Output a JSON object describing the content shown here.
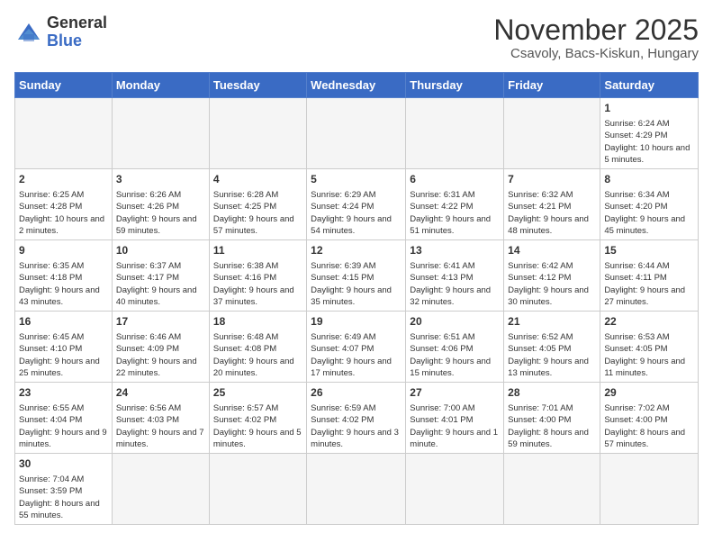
{
  "logo": {
    "text_general": "General",
    "text_blue": "Blue"
  },
  "header": {
    "month": "November 2025",
    "location": "Csavoly, Bacs-Kiskun, Hungary"
  },
  "weekdays": [
    "Sunday",
    "Monday",
    "Tuesday",
    "Wednesday",
    "Thursday",
    "Friday",
    "Saturday"
  ],
  "weeks": [
    [
      {
        "day": "",
        "info": ""
      },
      {
        "day": "",
        "info": ""
      },
      {
        "day": "",
        "info": ""
      },
      {
        "day": "",
        "info": ""
      },
      {
        "day": "",
        "info": ""
      },
      {
        "day": "",
        "info": ""
      },
      {
        "day": "1",
        "info": "Sunrise: 6:24 AM\nSunset: 4:29 PM\nDaylight: 10 hours and 5 minutes."
      }
    ],
    [
      {
        "day": "2",
        "info": "Sunrise: 6:25 AM\nSunset: 4:28 PM\nDaylight: 10 hours and 2 minutes."
      },
      {
        "day": "3",
        "info": "Sunrise: 6:26 AM\nSunset: 4:26 PM\nDaylight: 9 hours and 59 minutes."
      },
      {
        "day": "4",
        "info": "Sunrise: 6:28 AM\nSunset: 4:25 PM\nDaylight: 9 hours and 57 minutes."
      },
      {
        "day": "5",
        "info": "Sunrise: 6:29 AM\nSunset: 4:24 PM\nDaylight: 9 hours and 54 minutes."
      },
      {
        "day": "6",
        "info": "Sunrise: 6:31 AM\nSunset: 4:22 PM\nDaylight: 9 hours and 51 minutes."
      },
      {
        "day": "7",
        "info": "Sunrise: 6:32 AM\nSunset: 4:21 PM\nDaylight: 9 hours and 48 minutes."
      },
      {
        "day": "8",
        "info": "Sunrise: 6:34 AM\nSunset: 4:20 PM\nDaylight: 9 hours and 45 minutes."
      }
    ],
    [
      {
        "day": "9",
        "info": "Sunrise: 6:35 AM\nSunset: 4:18 PM\nDaylight: 9 hours and 43 minutes."
      },
      {
        "day": "10",
        "info": "Sunrise: 6:37 AM\nSunset: 4:17 PM\nDaylight: 9 hours and 40 minutes."
      },
      {
        "day": "11",
        "info": "Sunrise: 6:38 AM\nSunset: 4:16 PM\nDaylight: 9 hours and 37 minutes."
      },
      {
        "day": "12",
        "info": "Sunrise: 6:39 AM\nSunset: 4:15 PM\nDaylight: 9 hours and 35 minutes."
      },
      {
        "day": "13",
        "info": "Sunrise: 6:41 AM\nSunset: 4:13 PM\nDaylight: 9 hours and 32 minutes."
      },
      {
        "day": "14",
        "info": "Sunrise: 6:42 AM\nSunset: 4:12 PM\nDaylight: 9 hours and 30 minutes."
      },
      {
        "day": "15",
        "info": "Sunrise: 6:44 AM\nSunset: 4:11 PM\nDaylight: 9 hours and 27 minutes."
      }
    ],
    [
      {
        "day": "16",
        "info": "Sunrise: 6:45 AM\nSunset: 4:10 PM\nDaylight: 9 hours and 25 minutes."
      },
      {
        "day": "17",
        "info": "Sunrise: 6:46 AM\nSunset: 4:09 PM\nDaylight: 9 hours and 22 minutes."
      },
      {
        "day": "18",
        "info": "Sunrise: 6:48 AM\nSunset: 4:08 PM\nDaylight: 9 hours and 20 minutes."
      },
      {
        "day": "19",
        "info": "Sunrise: 6:49 AM\nSunset: 4:07 PM\nDaylight: 9 hours and 17 minutes."
      },
      {
        "day": "20",
        "info": "Sunrise: 6:51 AM\nSunset: 4:06 PM\nDaylight: 9 hours and 15 minutes."
      },
      {
        "day": "21",
        "info": "Sunrise: 6:52 AM\nSunset: 4:05 PM\nDaylight: 9 hours and 13 minutes."
      },
      {
        "day": "22",
        "info": "Sunrise: 6:53 AM\nSunset: 4:05 PM\nDaylight: 9 hours and 11 minutes."
      }
    ],
    [
      {
        "day": "23",
        "info": "Sunrise: 6:55 AM\nSunset: 4:04 PM\nDaylight: 9 hours and 9 minutes."
      },
      {
        "day": "24",
        "info": "Sunrise: 6:56 AM\nSunset: 4:03 PM\nDaylight: 9 hours and 7 minutes."
      },
      {
        "day": "25",
        "info": "Sunrise: 6:57 AM\nSunset: 4:02 PM\nDaylight: 9 hours and 5 minutes."
      },
      {
        "day": "26",
        "info": "Sunrise: 6:59 AM\nSunset: 4:02 PM\nDaylight: 9 hours and 3 minutes."
      },
      {
        "day": "27",
        "info": "Sunrise: 7:00 AM\nSunset: 4:01 PM\nDaylight: 9 hours and 1 minute."
      },
      {
        "day": "28",
        "info": "Sunrise: 7:01 AM\nSunset: 4:00 PM\nDaylight: 8 hours and 59 minutes."
      },
      {
        "day": "29",
        "info": "Sunrise: 7:02 AM\nSunset: 4:00 PM\nDaylight: 8 hours and 57 minutes."
      }
    ],
    [
      {
        "day": "30",
        "info": "Sunrise: 7:04 AM\nSunset: 3:59 PM\nDaylight: 8 hours and 55 minutes."
      },
      {
        "day": "",
        "info": ""
      },
      {
        "day": "",
        "info": ""
      },
      {
        "day": "",
        "info": ""
      },
      {
        "day": "",
        "info": ""
      },
      {
        "day": "",
        "info": ""
      },
      {
        "day": "",
        "info": ""
      }
    ]
  ]
}
